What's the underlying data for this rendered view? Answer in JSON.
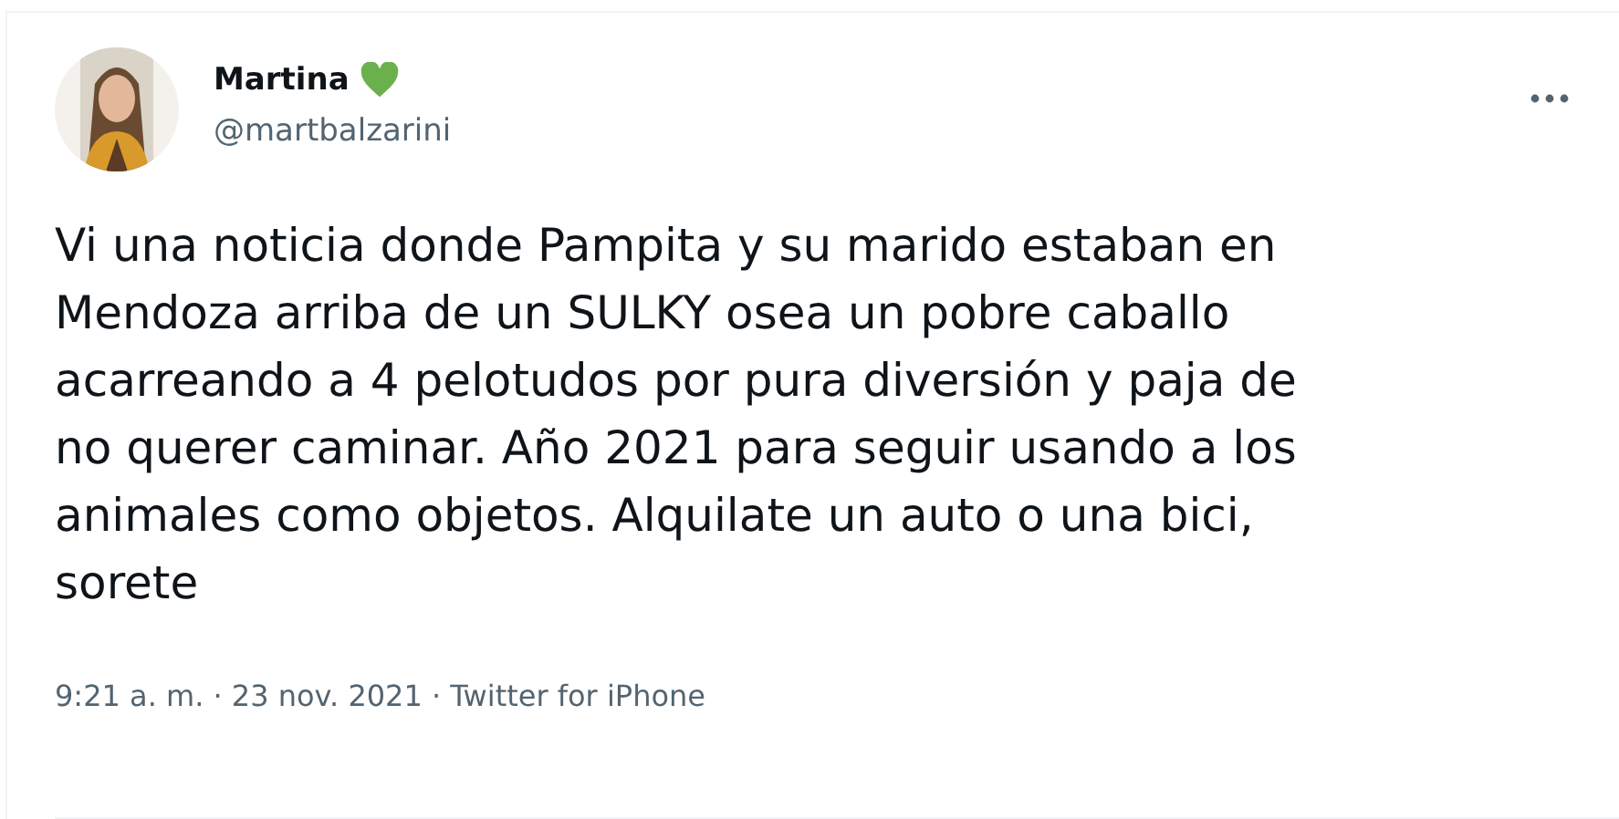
{
  "tweet": {
    "author": {
      "name": "Martina",
      "handle": "@martbalzarini"
    },
    "text_lines": [
      "Vi una noticia donde Pampita y su marido estaban en",
      "Mendoza arriba de un SULKY osea un pobre caballo",
      "acarreando a 4 pelotudos por pura diversión y paja de",
      "no querer caminar. Año 2021 para seguir usando a los",
      "animales como objetos. Alquilate un auto o una bici,",
      "sorete"
    ],
    "timestamp": "9:21 a. m. · 23 nov. 2021 · Twitter for iPhone"
  }
}
